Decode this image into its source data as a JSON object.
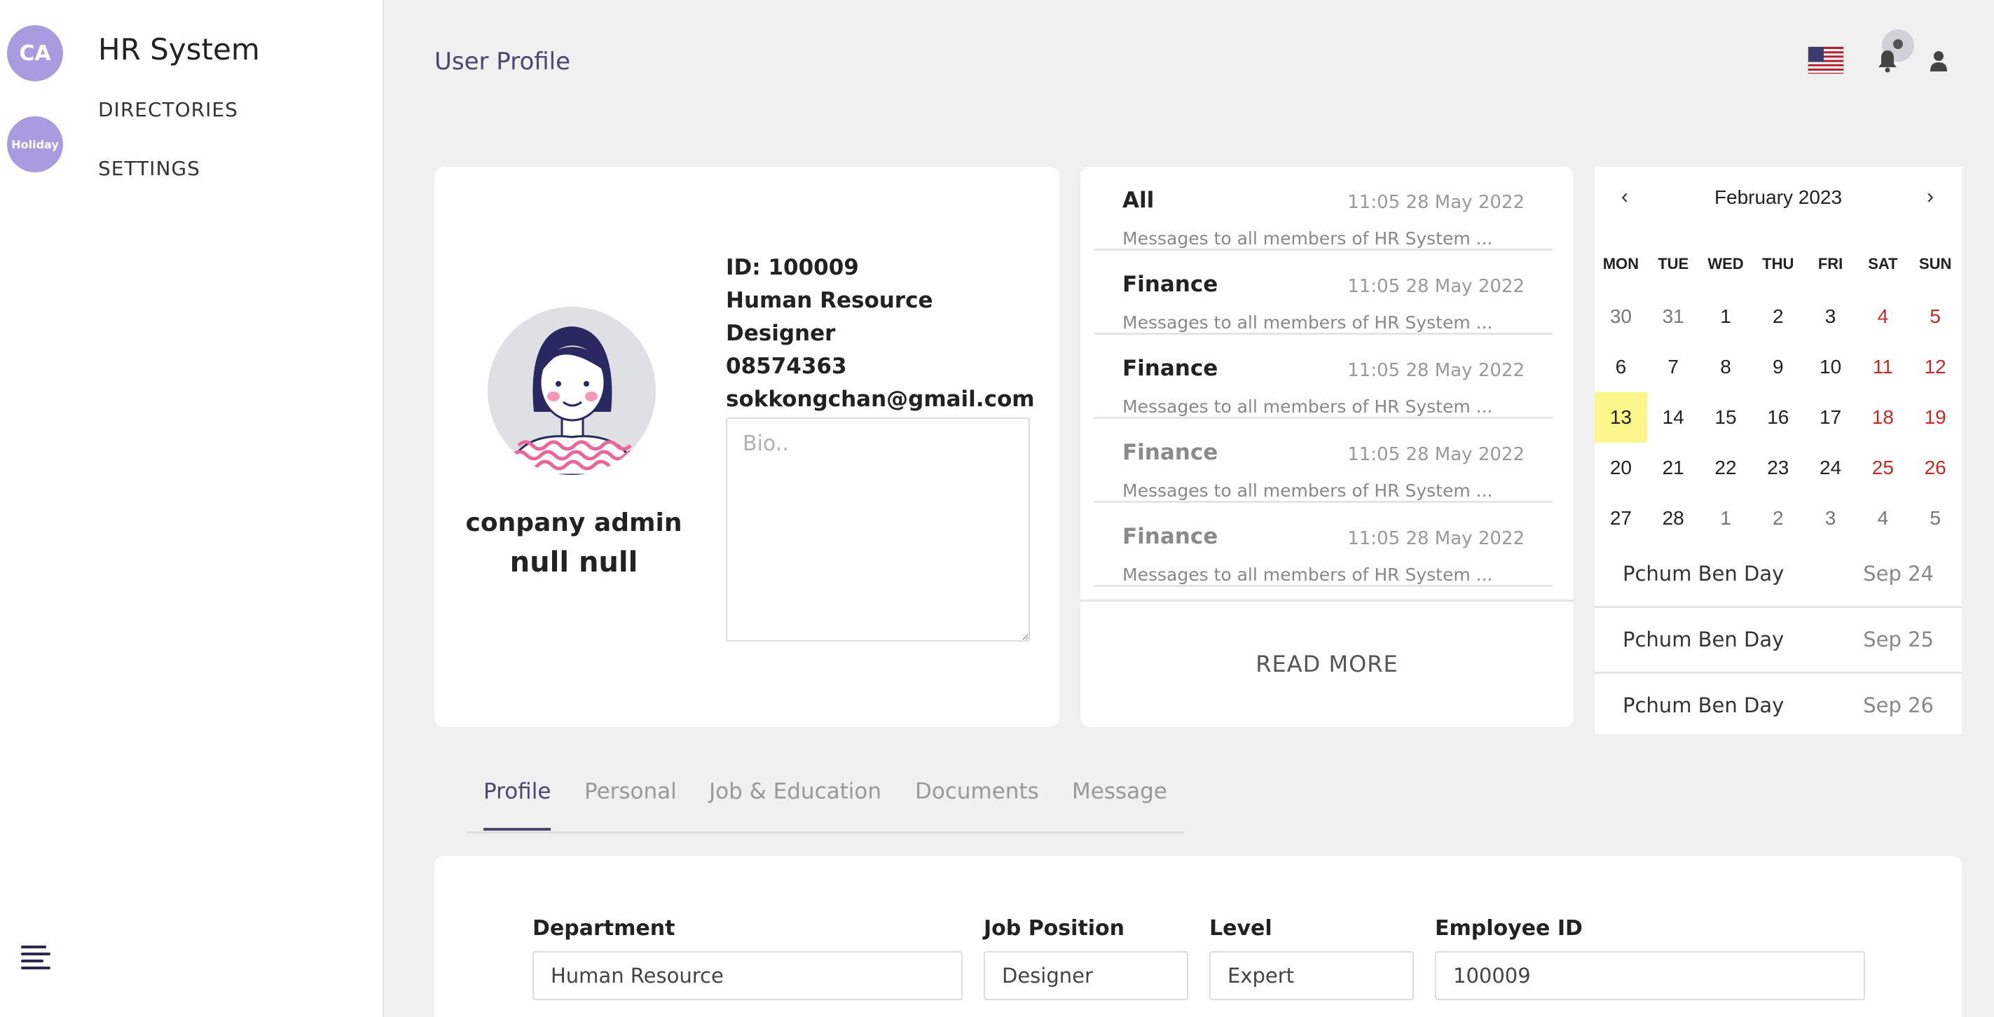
{
  "sidebar": {
    "avatar_initials": "CA",
    "holiday_badge": "Holiday",
    "app_title": "HR System",
    "nav": [
      "DIRECTORIES",
      "SETTINGS"
    ]
  },
  "header": {
    "title": "User Profile",
    "icons": [
      "us-flag-icon",
      "bell-icon",
      "user-icon"
    ]
  },
  "profile": {
    "name_line1": "conpany admin",
    "name_line2": "null null",
    "id": "ID: 100009",
    "department": "Human Resource",
    "position": "Designer",
    "phone": "08574363",
    "email": "sokkongchan@gmail.com",
    "bio_placeholder": "Bio.."
  },
  "messages": {
    "items": [
      {
        "title": "All",
        "time": "11:05 28 May 2022",
        "body": "Messages to all members of HR System ..."
      },
      {
        "title": "Finance",
        "time": "11:05 28 May 2022",
        "body": "Messages to all members of HR System ..."
      },
      {
        "title": "Finance",
        "time": "11:05 28 May 2022",
        "body": "Messages to all members of HR System ..."
      },
      {
        "title": "Finance",
        "time": "11:05 28 May 2022",
        "body": "Messages to all members of HR System ..."
      },
      {
        "title": "Finance",
        "time": "11:05 28 May 2022",
        "body": "Messages to all members of HR System ..."
      }
    ],
    "read_more": "READ MORE"
  },
  "calendar": {
    "prev": "‹",
    "next": "›",
    "month": "February 2023",
    "weekdays": [
      "MON",
      "TUE",
      "WED",
      "THU",
      "FRI",
      "SAT",
      "SUN"
    ],
    "weeks": [
      [
        "30",
        "31",
        "1",
        "2",
        "3",
        "4",
        "5"
      ],
      [
        "6",
        "7",
        "8",
        "9",
        "10",
        "11",
        "12"
      ],
      [
        "13",
        "14",
        "15",
        "16",
        "17",
        "18",
        "19"
      ],
      [
        "20",
        "21",
        "22",
        "23",
        "24",
        "25",
        "26"
      ],
      [
        "27",
        "28",
        "1",
        "2",
        "3",
        "4",
        "5"
      ]
    ],
    "today": "13",
    "holidays": [
      {
        "name": "Pchum Ben Day",
        "date": "Sep 24"
      },
      {
        "name": "Pchum Ben Day",
        "date": "Sep 25"
      },
      {
        "name": "Pchum Ben Day",
        "date": "Sep 26"
      }
    ]
  },
  "tabs": [
    "Profile",
    "Personal",
    "Job & Education",
    "Documents",
    "Message"
  ],
  "active_tab": "Profile",
  "form": {
    "fields": [
      {
        "label": "Department",
        "value": "Human Resource"
      },
      {
        "label": "Job Position",
        "value": "Designer"
      },
      {
        "label": "Level",
        "value": "Expert"
      },
      {
        "label": "Employee ID",
        "value": "100009"
      }
    ]
  },
  "colors": {
    "accent": "#4a4870",
    "avatar_bg": "#a89be0",
    "weekend": "#c62828",
    "today_highlight": "#fbf68a"
  }
}
